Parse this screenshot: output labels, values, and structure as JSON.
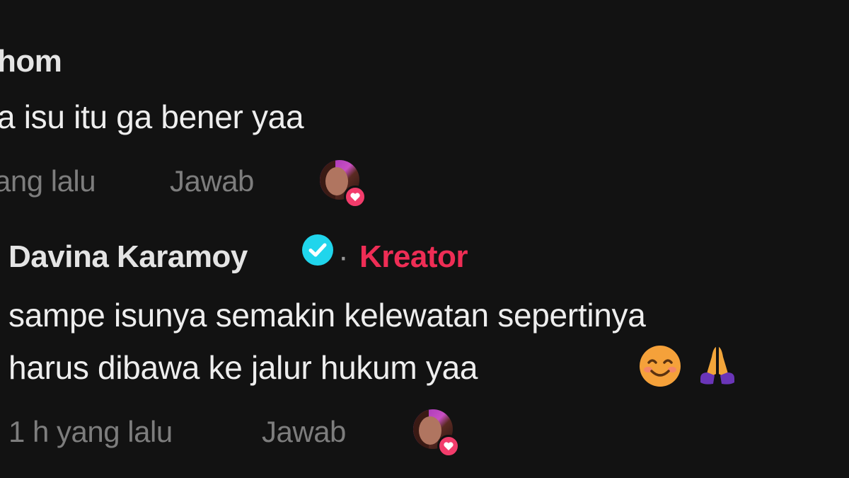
{
  "comment_1": {
    "username": "hom",
    "text": "a isu itu ga bener yaa",
    "time": "ang lalu",
    "reply_label": "Jawab",
    "liked_by_creator_icon": "creator-avatar-heart"
  },
  "comment_2": {
    "username": "Davina Karamoy",
    "verified_icon": "verified-check-icon",
    "separator": "·",
    "badge": "Kreator",
    "text_line1": "sampe isunya semakin kelewatan sepertinya",
    "text_line2": "harus dibawa ke jalur hukum yaa",
    "emojis": [
      "smiling-face-emoji",
      "folded-hands-emoji"
    ],
    "time": "1 h yang lalu",
    "reply_label": "Jawab",
    "liked_by_creator_icon": "creator-avatar-heart"
  },
  "colors": {
    "background": "#121212",
    "creator_badge": "#ee2d55",
    "verified": "#20d5ec",
    "heart": "#f23c6b",
    "meta_text": "#7d7d7d"
  }
}
